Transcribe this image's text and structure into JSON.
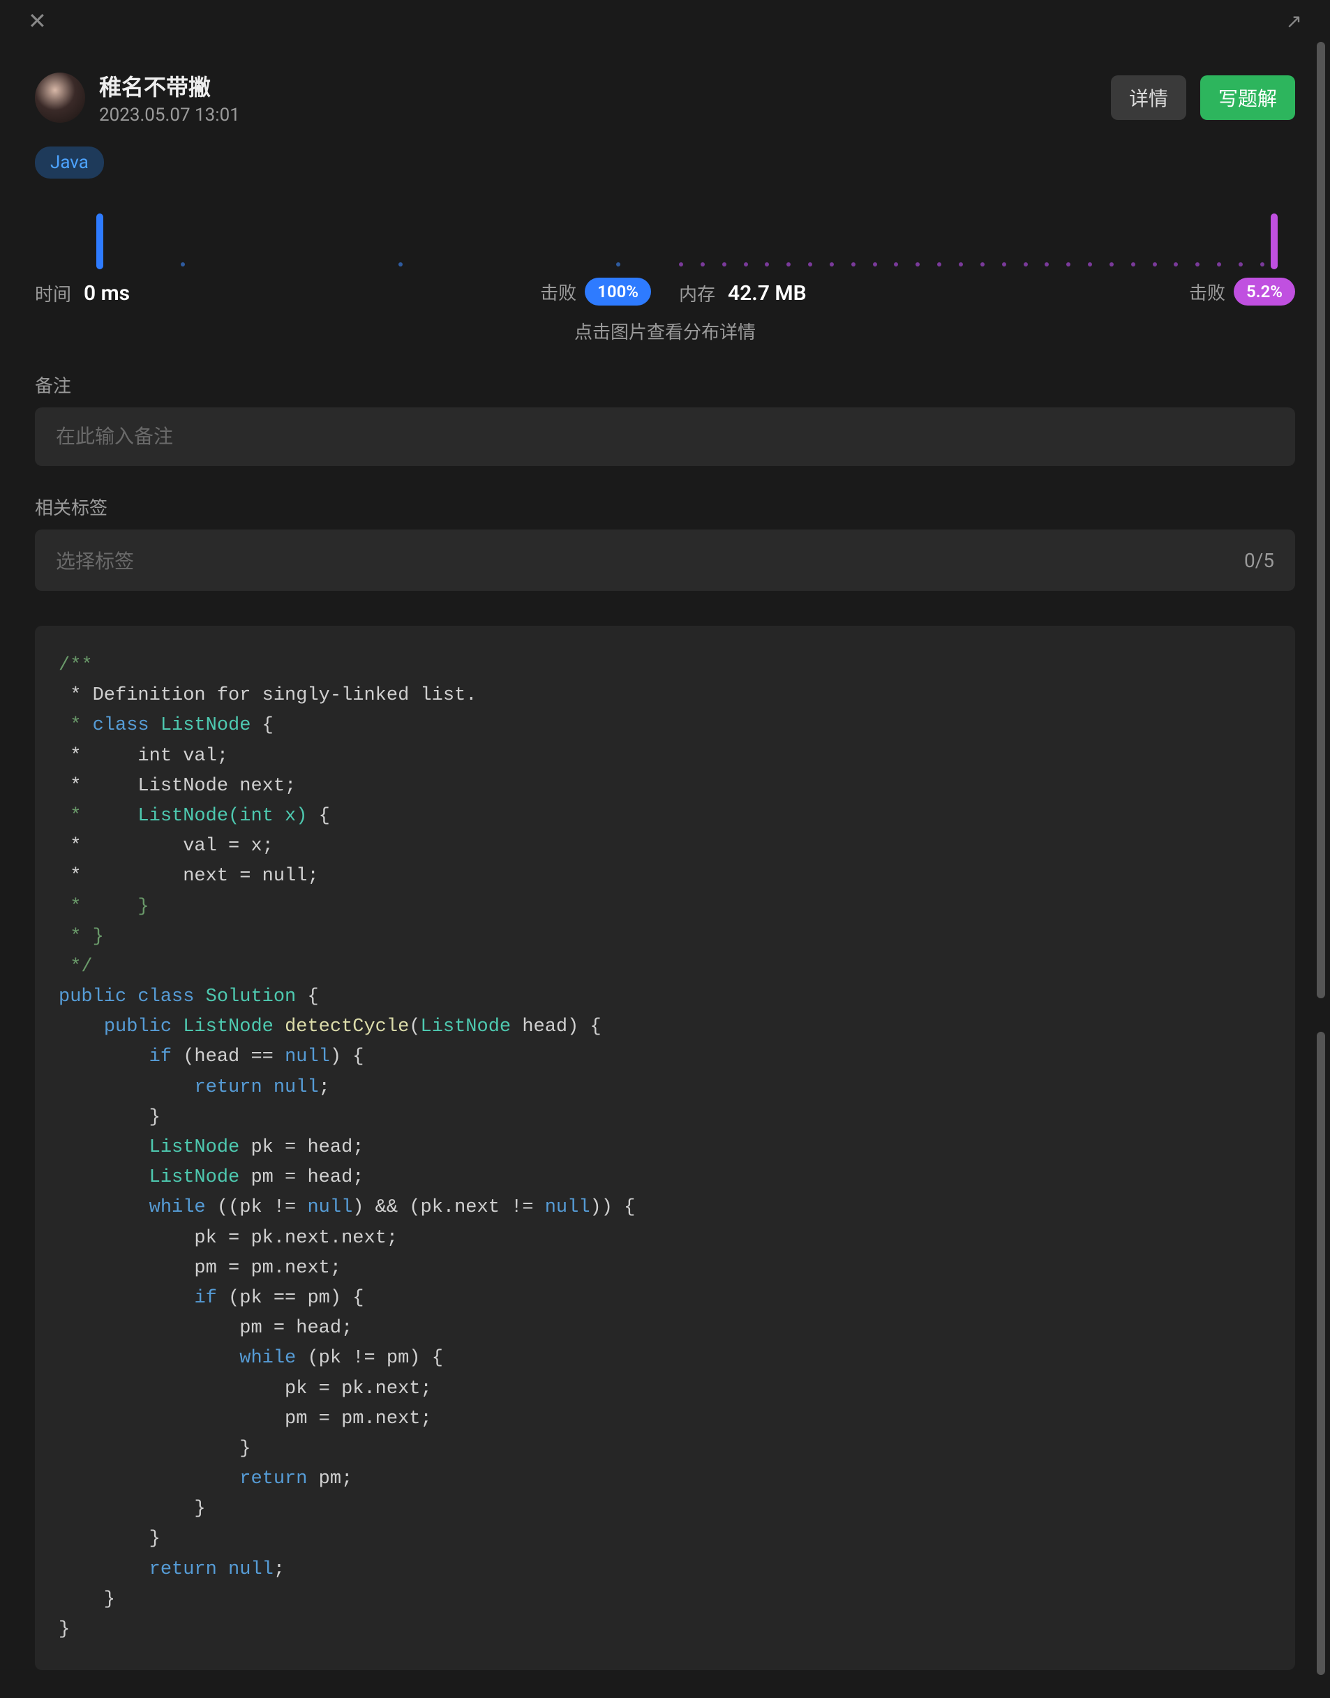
{
  "topbar": {
    "close_glyph": "✕",
    "open_glyph": "↗"
  },
  "user": {
    "name": "稚名不带撇",
    "datetime": "2023.05.07 13:01"
  },
  "actions": {
    "details": "详情",
    "write_solution": "写题解"
  },
  "language_tag": "Java",
  "stats": {
    "time": {
      "label": "时间",
      "value": "0 ms",
      "beat_label": "击败",
      "beat_value": "100%"
    },
    "memory": {
      "label": "内存",
      "value": "42.7 MB",
      "beat_label": "击败",
      "beat_value": "5.2%"
    },
    "hint": "点击图片查看分布详情"
  },
  "notes": {
    "section_label": "备注",
    "placeholder": "在此输入备注"
  },
  "tags": {
    "section_label": "相关标签",
    "placeholder": "选择标签",
    "count": "0/5"
  },
  "code": {
    "l1": "/**",
    "l2": " * Definition for singly-linked list.",
    "l3a": " * ",
    "l3b": "class",
    "l3c": " ",
    "l3d": "ListNode",
    "l3e": " {",
    "l4": " *     int val;",
    "l5": " *     ListNode next;",
    "l6a": " *     ",
    "l6b": "ListNode(int x)",
    "l6c": " {",
    "l7": " *         val = x;",
    "l8": " *         next = null;",
    "l9": " *     }",
    "l10": " * }",
    "l11": " */",
    "l12a": "public",
    "l12b": " ",
    "l12c": "class",
    "l12d": " ",
    "l12e": "Solution",
    "l12f": " {",
    "l13a": "    ",
    "l13b": "public",
    "l13c": " ",
    "l13d": "ListNode",
    "l13e": " ",
    "l13f": "detectCycle",
    "l13g": "(",
    "l13h": "ListNode",
    "l13i": " head) {",
    "l14a": "        ",
    "l14b": "if",
    "l14c": " (head == ",
    "l14d": "null",
    "l14e": ") {",
    "l15a": "            ",
    "l15b": "return",
    "l15c": " ",
    "l15d": "null",
    "l15e": ";",
    "l16": "        }",
    "l17a": "        ",
    "l17b": "ListNode",
    "l17c": " pk = head;",
    "l18a": "        ",
    "l18b": "ListNode",
    "l18c": " pm = head;",
    "l19a": "        ",
    "l19b": "while",
    "l19c": " ((pk != ",
    "l19d": "null",
    "l19e": ") && (pk.next != ",
    "l19f": "null",
    "l19g": ")) {",
    "l20": "            pk = pk.next.next;",
    "l21": "            pm = pm.next;",
    "l22a": "            ",
    "l22b": "if",
    "l22c": " (pk == pm) {",
    "l23": "                pm = head;",
    "l24a": "                ",
    "l24b": "while",
    "l24c": " (pk != pm) {",
    "l25": "                    pk = pk.next;",
    "l26": "                    pm = pm.next;",
    "l27": "                }",
    "l28a": "                ",
    "l28b": "return",
    "l28c": " pm;",
    "l29": "            }",
    "l30": "        }",
    "l31a": "        ",
    "l31b": "return",
    "l31c": " ",
    "l31d": "null",
    "l31e": ";",
    "l32": "    }",
    "l33": "}"
  }
}
